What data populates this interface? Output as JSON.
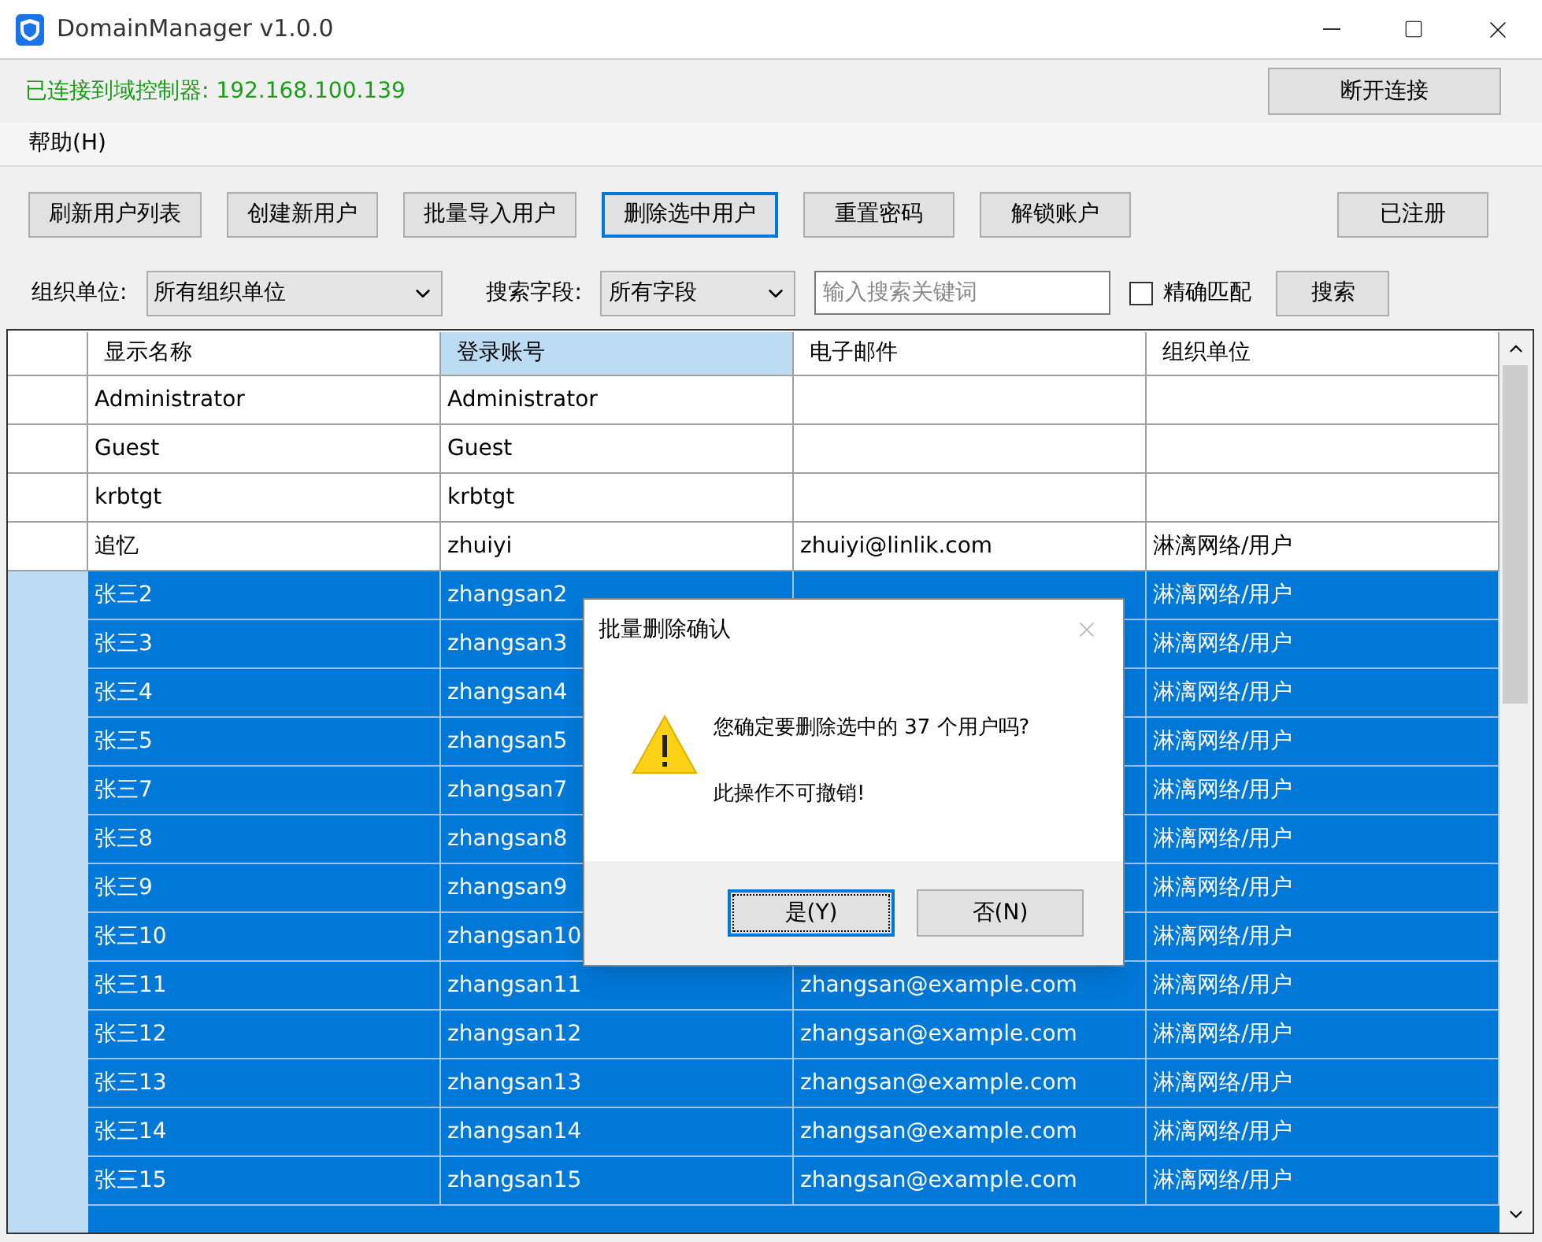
{
  "window": {
    "title": "DomainManager v1.0.0"
  },
  "status": {
    "text": "已连接到域控制器: 192.168.100.139",
    "disconnect_button": "断开连接"
  },
  "menu": [
    "帮助(H)"
  ],
  "toolbar": [
    {
      "label": "刷新用户列表",
      "focused": false
    },
    {
      "label": "创建新用户",
      "focused": false
    },
    {
      "label": "批量导入用户",
      "focused": false
    },
    {
      "label": "删除选中用户",
      "focused": true
    },
    {
      "label": "重置密码",
      "focused": false
    },
    {
      "label": "解锁账户",
      "focused": false
    }
  ],
  "register_button": "已注册",
  "filters": {
    "ou_label": "组织单位:",
    "ou_value": "所有组织单位",
    "field_label": "搜索字段:",
    "field_value": "所有字段",
    "search": {
      "placeholder": "输入搜索关键词"
    },
    "exact_match": {
      "label": "精确匹配",
      "checked": false
    },
    "search_button": "搜索"
  },
  "table": {
    "columns": [
      {
        "label": "显示名称",
        "selected": false
      },
      {
        "label": "登录账号",
        "selected": true
      },
      {
        "label": "电子邮件",
        "selected": false
      },
      {
        "label": "组织单位",
        "selected": false
      }
    ],
    "rows": [
      {
        "display_name": "Administrator",
        "login": "Administrator",
        "selected": false
      },
      {
        "display_name": "Guest",
        "login": "Guest",
        "selected": false
      },
      {
        "display_name": "krbtgt",
        "login": "krbtgt",
        "selected": false
      },
      {
        "display_name": "追忆",
        "login": "zhuiyi",
        "email": "zhuiyi@linlik.com",
        "ou": "淋漓网络/用户",
        "selected": false
      },
      {
        "display_name": "张三2",
        "login": "zhangsan2",
        "ou": "淋漓网络/用户",
        "selected": true
      },
      {
        "display_name": "张三3",
        "login": "zhangsan3",
        "ou": "淋漓网络/用户",
        "selected": true
      },
      {
        "display_name": "张三4",
        "login": "zhangsan4",
        "ou": "淋漓网络/用户",
        "selected": true
      },
      {
        "display_name": "张三5",
        "login": "zhangsan5",
        "ou": "淋漓网络/用户",
        "selected": true
      },
      {
        "display_name": "张三7",
        "login": "zhangsan7",
        "ou": "淋漓网络/用户",
        "selected": true
      },
      {
        "display_name": "张三8",
        "login": "zhangsan8",
        "ou": "淋漓网络/用户",
        "selected": true
      },
      {
        "display_name": "张三9",
        "login": "zhangsan9",
        "ou": "淋漓网络/用户",
        "selected": true
      },
      {
        "display_name": "张三10",
        "login": "zhangsan10",
        "ou": "淋漓网络/用户",
        "selected": true
      },
      {
        "display_name": "张三11",
        "login": "zhangsan11",
        "email": "zhangsan@example.com",
        "ou": "淋漓网络/用户",
        "selected": true
      },
      {
        "display_name": "张三12",
        "login": "zhangsan12",
        "email": "zhangsan@example.com",
        "ou": "淋漓网络/用户",
        "selected": true
      },
      {
        "display_name": "张三13",
        "login": "zhangsan13",
        "email": "zhangsan@example.com",
        "ou": "淋漓网络/用户",
        "selected": true
      },
      {
        "display_name": "张三14",
        "login": "zhangsan14",
        "email": "zhangsan@example.com",
        "ou": "淋漓网络/用户",
        "selected": true
      },
      {
        "display_name": "张三15",
        "login": "zhangsan15",
        "email": "zhangsan@example.com",
        "ou": "淋漓网络/用户",
        "selected": true
      }
    ]
  },
  "dialog": {
    "title": "批量删除确认",
    "message": "您确定要删除选中的 37 个用户吗?",
    "warning": "此操作不可撤销!",
    "buttons": [
      {
        "label": "是(Y)",
        "focused": true
      },
      {
        "label": "否(N)",
        "focused": false
      }
    ]
  }
}
